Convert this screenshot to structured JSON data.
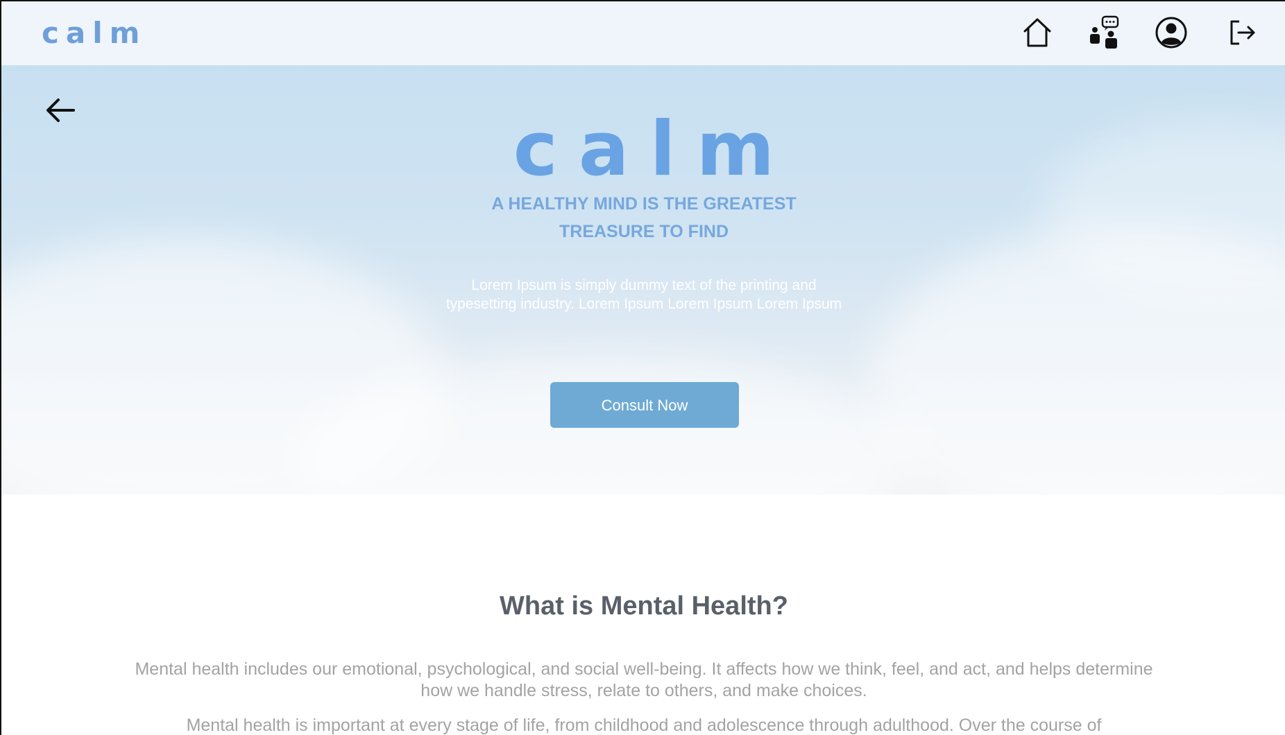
{
  "nav": {
    "brand": "calm",
    "icons": [
      "home-icon",
      "consult-chat-icon",
      "profile-icon",
      "logout-icon"
    ],
    "background": "#eff5fa",
    "brand_color": "#6f9fd8"
  },
  "hero": {
    "back_icon": "arrow-left-icon",
    "logo": "calm",
    "tagline_line1": "A HEALTHY MIND IS THE GREATEST",
    "tagline_line2": "TREASURE TO FIND",
    "description": "Lorem Ipsum is simply dummy text of the printing and typesetting industry. Lorem Ipsum  Lorem Ipsum  Lorem Ipsum",
    "cta_label": "Consult Now",
    "logo_color": "#6aa3e3",
    "tagline_color": "#77a7dd",
    "cta_color": "#6eaad4"
  },
  "content": {
    "title": "What is Mental Health?",
    "paragraph1": "Mental health includes our emotional, psychological, and social well-being. It affects how we think, feel, and act, and helps determine how we handle stress, relate to others, and make choices.",
    "paragraph2": "Mental health is important at every stage of life, from childhood and adolescence through adulthood. Over the course of",
    "title_color": "#5a6069",
    "text_color": "#a3a3a3"
  }
}
